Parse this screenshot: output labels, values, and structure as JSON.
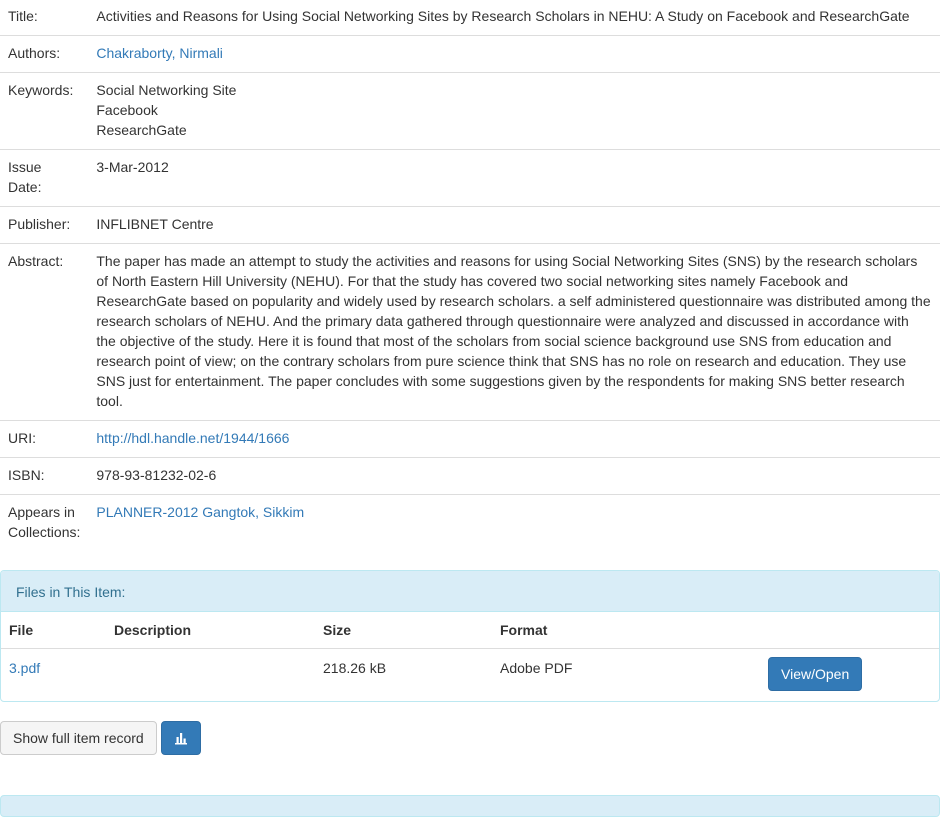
{
  "metadata": {
    "title_label": "Title:",
    "title": "Activities and Reasons for Using Social Networking Sites by Research Scholars in NEHU: A Study on Facebook and ResearchGate",
    "authors_label": "Authors:",
    "author": "Chakraborty, Nirmali",
    "keywords_label": "Keywords:",
    "keywords": [
      "Social Networking Site",
      "Facebook",
      "ResearchGate"
    ],
    "issue_date_label_1": "Issue",
    "issue_date_label_2": "Date:",
    "issue_date": "3-Mar-2012",
    "publisher_label": "Publisher:",
    "publisher": "INFLIBNET Centre",
    "abstract_label": "Abstract:",
    "abstract": "The paper has made an attempt to study the activities and reasons for using Social Networking Sites (SNS) by the research scholars of North Eastern Hill University (NEHU). For that the study has covered two social networking sites namely Facebook and ResearchGate based on popularity and widely used by research scholars. a self administered questionnaire was distributed among the research scholars of NEHU. And the primary data gathered through questionnaire were analyzed and discussed in accordance with the objective of the study. Here it is found that most of the scholars from social science background use SNS from education and research point of view; on the contrary scholars from pure science think that SNS has no role on research and education. They use SNS just for entertainment. The paper concludes with some suggestions given by the respondents for making SNS better research tool.",
    "uri_label": "URI:",
    "uri": "http://hdl.handle.net/1944/1666",
    "isbn_label": "ISBN:",
    "isbn": "978-93-81232-02-6",
    "collections_label_1": "Appears in",
    "collections_label_2": "Collections:",
    "collection": "PLANNER-2012 Gangtok, Sikkim"
  },
  "files": {
    "heading": "Files in This Item:",
    "columns": {
      "file": "File",
      "description": "Description",
      "size": "Size",
      "format": "Format"
    },
    "rows": [
      {
        "file": "3.pdf",
        "description": "",
        "size": "218.26 kB",
        "format": "Adobe PDF",
        "action": "View/Open"
      }
    ]
  },
  "actions": {
    "full_record": "Show full item record",
    "stats_icon": "bar-chart-icon"
  },
  "colors": {
    "link": "#337ab7",
    "primary": "#337ab7",
    "panel_heading_bg": "#d9edf7",
    "panel_heading_text": "#31708f"
  }
}
